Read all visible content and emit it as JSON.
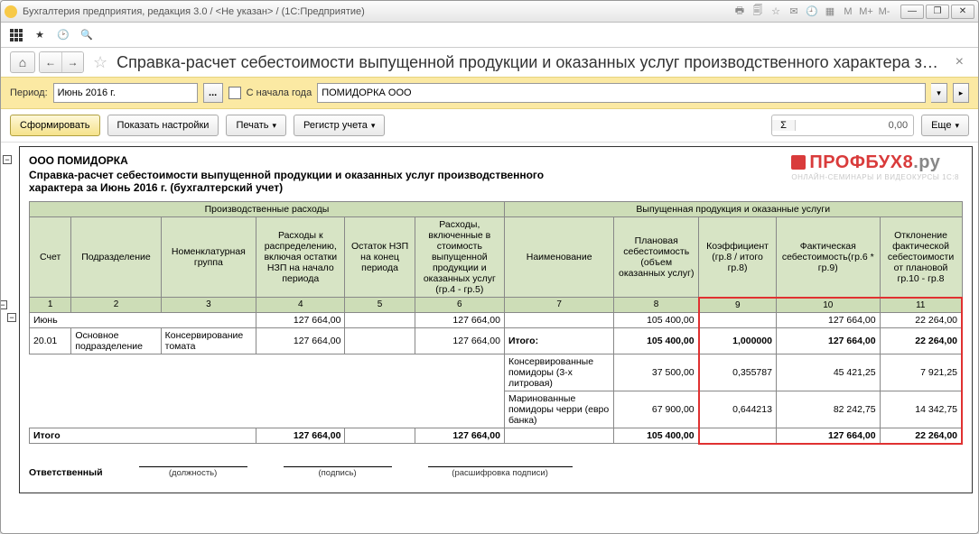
{
  "window": {
    "title": "Бухгалтерия предприятия, редакция 3.0 / <Не указан> / (1С:Предприятие)",
    "sys_icons": [
      "print",
      "calc",
      "star",
      "mail",
      "clock",
      "grid",
      "M",
      "M+",
      "M-"
    ],
    "winbtns": {
      "min": "—",
      "max": "❐",
      "close": "✕"
    }
  },
  "nav": {
    "home": "⌂",
    "back": "←",
    "fwd": "→",
    "star": "☆",
    "doc_title": "Справка-расчет себестоимости выпущенной продукции и оказанных услуг производственного характера за Июн...",
    "close": "×"
  },
  "filter": {
    "period_label": "Период:",
    "period_value": "Июнь 2016 г.",
    "dots": "...",
    "from_start_label": "С начала года",
    "org_value": "ПОМИДОРКА ООО"
  },
  "actions": {
    "generate": "Сформировать",
    "show_settings": "Показать настройки",
    "print": "Печать",
    "register": "Регистр учета",
    "sum_value": "0,00",
    "more": "Еще"
  },
  "report": {
    "org": "ООО ПОМИДОРКА",
    "title": "Справка-расчет себестоимости выпущенной продукции и оказанных услуг производственного характера  за Июнь 2016 г. (бухгалтерский учет)",
    "watermark_main": "ПРОФБУХ8",
    "watermark_suffix": ".ру",
    "watermark_sub": "ОНЛАЙН-СЕМИНАРЫ И ВИДЕОКУРСЫ 1С:8",
    "group1": "Производственные расходы",
    "group2": "Выпущенная  продукция и оказанные услуги",
    "headers": {
      "c1": "Счет",
      "c2": "Подразделение",
      "c3": "Номенклатурная группа",
      "c4": "Расходы к распределению, включая остатки НЗП на начало периода",
      "c5": "Остаток НЗП на конец периода",
      "c6": "Расходы, включенные в стоимость выпущенной продукции и оказанных услуг (гр.4 - гр.5)",
      "c7": "Наименование",
      "c8": "Плановая себестоимость (объем оказанных услуг)",
      "c9": "Коэффициент (гр.8 / итого гр.8)",
      "c10": "Фактическая себестоимость(гр.6 * гр.9)",
      "c11": "Отклонение фактической себестоимости от плановой гр.10 - гр.8"
    },
    "colnums": [
      "1",
      "2",
      "3",
      "4",
      "5",
      "6",
      "7",
      "8",
      "9",
      "10",
      "11"
    ],
    "rows": {
      "month": {
        "label": "Июнь",
        "c4": "127 664,00",
        "c6": "127 664,00",
        "c8": "105 400,00",
        "c10": "127 664,00",
        "c11": "22 264,00"
      },
      "acc": {
        "c1": "20.01",
        "c2": "Основное подразделение",
        "c3": "Консервирование томата",
        "c4": "127 664,00",
        "c6": "127 664,00",
        "c7": "Итого:",
        "c8": "105 400,00",
        "c9": "1,000000",
        "c10": "127 664,00",
        "c11": "22 264,00"
      },
      "p1": {
        "c7": "Консервированные помидоры (3-х литровая)",
        "c8": "37 500,00",
        "c9": "0,355787",
        "c10": "45 421,25",
        "c11": "7 921,25"
      },
      "p2": {
        "c7": "Маринованные помидоры черри (евро банка)",
        "c8": "67 900,00",
        "c9": "0,644213",
        "c10": "82 242,75",
        "c11": "14 342,75"
      },
      "total": {
        "label": "Итого",
        "c4": "127 664,00",
        "c6": "127 664,00",
        "c8": "105 400,00",
        "c10": "127 664,00",
        "c11": "22 264,00"
      }
    },
    "sign": {
      "resp": "Ответственный",
      "pos": "(должность)",
      "sig": "(подпись)",
      "dec": "(расшифровка подписи)"
    }
  }
}
